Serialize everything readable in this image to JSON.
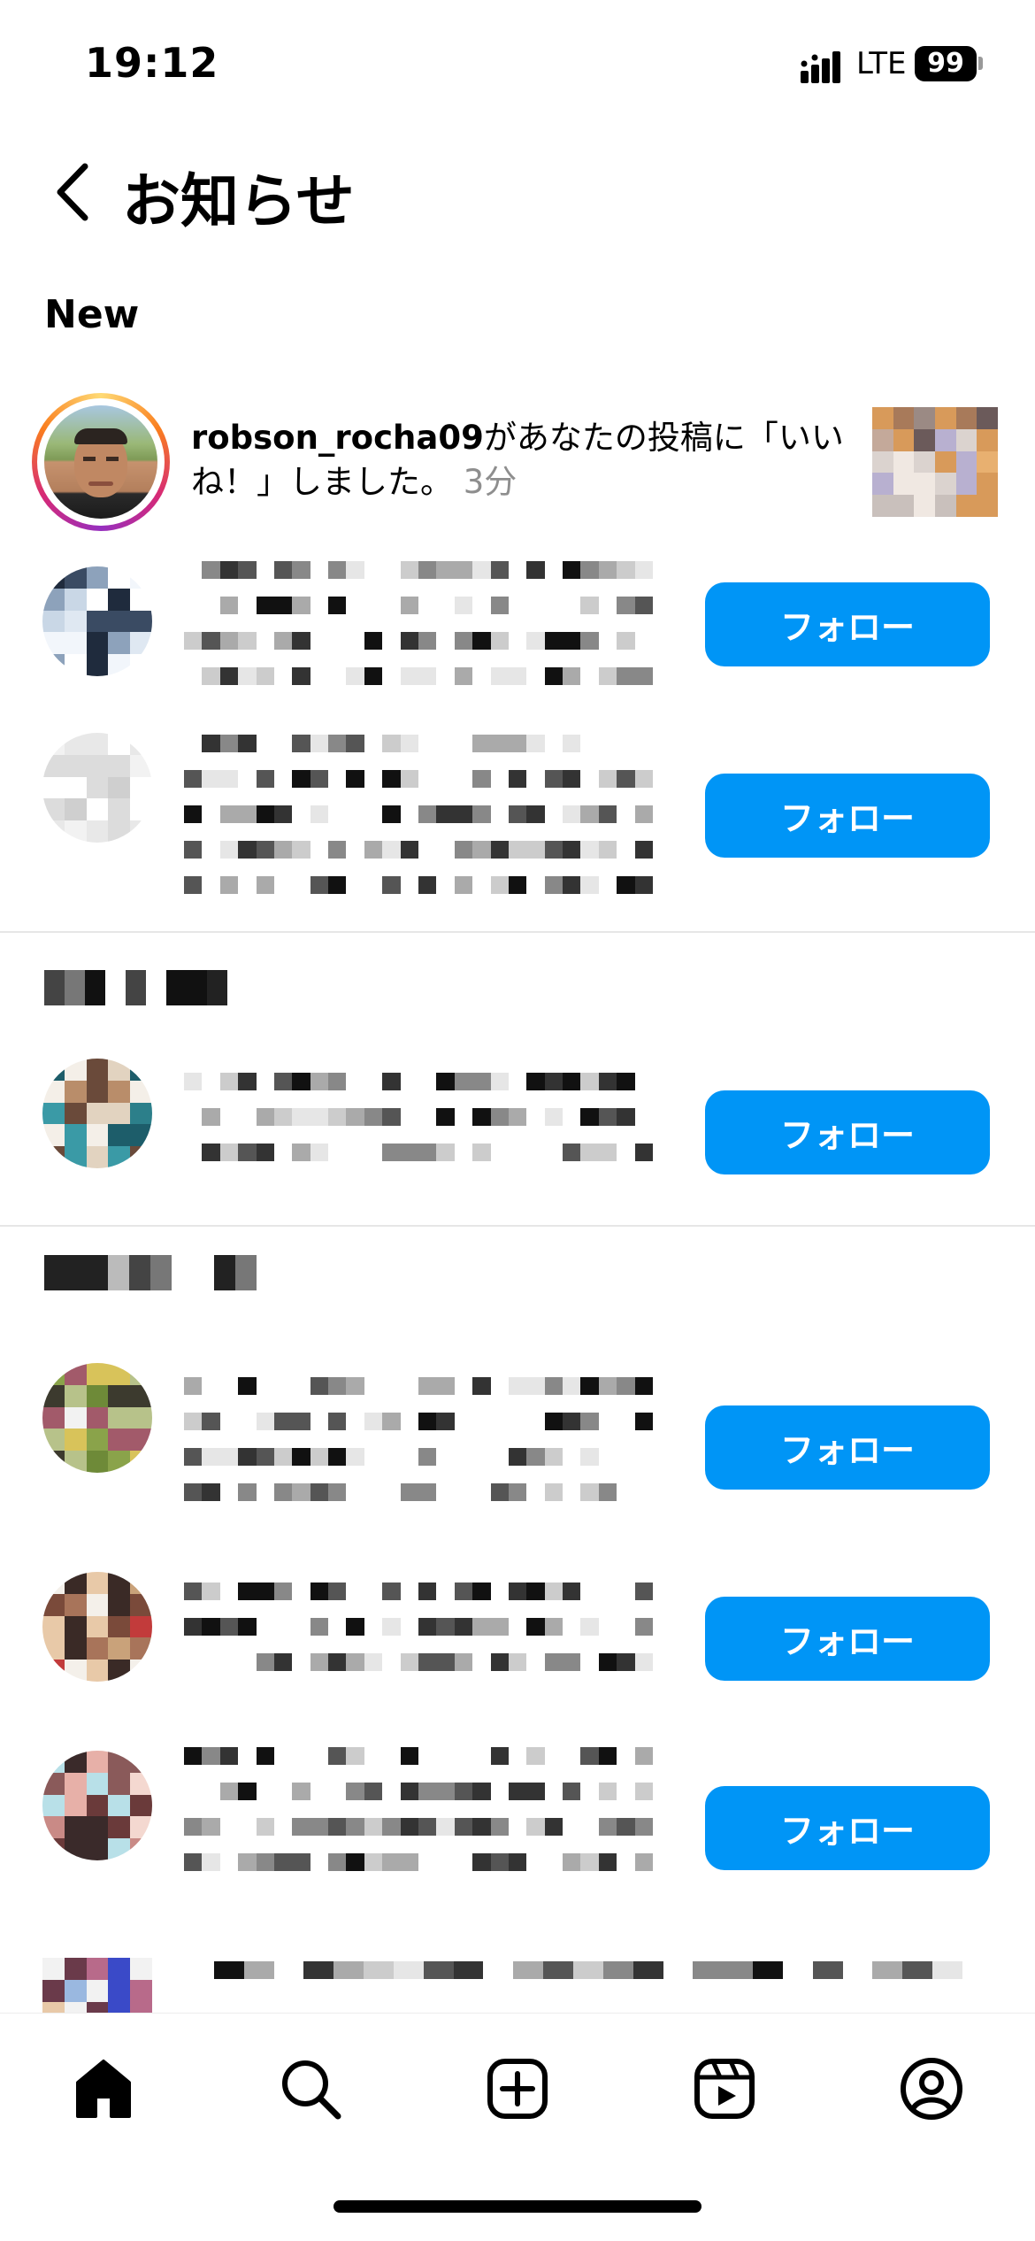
{
  "status_bar": {
    "time": "19:12",
    "network": "LTE",
    "battery": "99"
  },
  "header": {
    "title": "お知らせ",
    "back_icon": "chevron-left-icon"
  },
  "sections": {
    "new_label": "New"
  },
  "notification": {
    "username": "robson_rocha09",
    "message": "があなたの投稿に「いいね！」しました。",
    "time": "3分"
  },
  "follow_label": "フォロー",
  "tab_bar": {
    "tabs": [
      "home-icon",
      "search-icon",
      "create-post-icon",
      "reels-icon",
      "profile-icon"
    ],
    "active": "home-icon"
  },
  "colors": {
    "follow_button": "#0095f6",
    "text_secondary": "#8e8e8e",
    "background": "#ffffff"
  }
}
